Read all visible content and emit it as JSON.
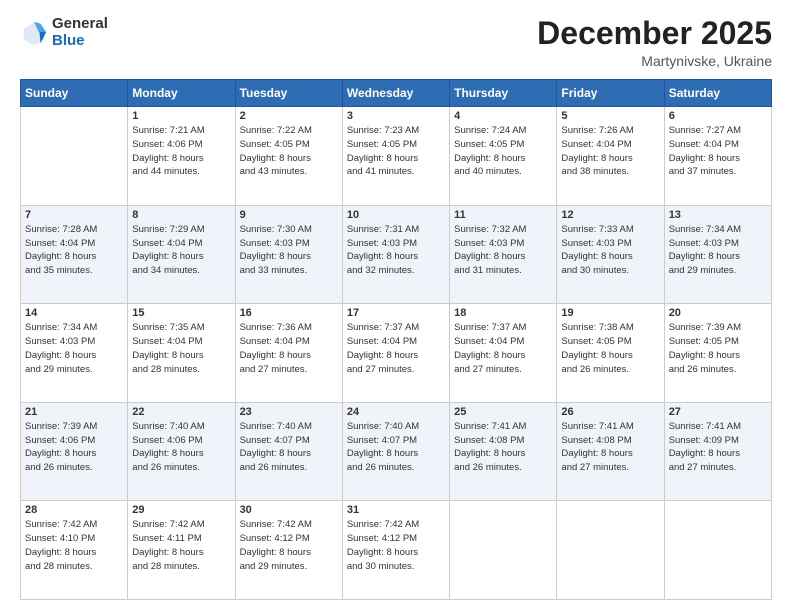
{
  "header": {
    "logo_general": "General",
    "logo_blue": "Blue",
    "title": "December 2025",
    "location": "Martynivske, Ukraine"
  },
  "days_of_week": [
    "Sunday",
    "Monday",
    "Tuesday",
    "Wednesday",
    "Thursday",
    "Friday",
    "Saturday"
  ],
  "weeks": [
    [
      {
        "day": "",
        "info": ""
      },
      {
        "day": "1",
        "info": "Sunrise: 7:21 AM\nSunset: 4:06 PM\nDaylight: 8 hours\nand 44 minutes."
      },
      {
        "day": "2",
        "info": "Sunrise: 7:22 AM\nSunset: 4:05 PM\nDaylight: 8 hours\nand 43 minutes."
      },
      {
        "day": "3",
        "info": "Sunrise: 7:23 AM\nSunset: 4:05 PM\nDaylight: 8 hours\nand 41 minutes."
      },
      {
        "day": "4",
        "info": "Sunrise: 7:24 AM\nSunset: 4:05 PM\nDaylight: 8 hours\nand 40 minutes."
      },
      {
        "day": "5",
        "info": "Sunrise: 7:26 AM\nSunset: 4:04 PM\nDaylight: 8 hours\nand 38 minutes."
      },
      {
        "day": "6",
        "info": "Sunrise: 7:27 AM\nSunset: 4:04 PM\nDaylight: 8 hours\nand 37 minutes."
      }
    ],
    [
      {
        "day": "7",
        "info": "Sunrise: 7:28 AM\nSunset: 4:04 PM\nDaylight: 8 hours\nand 35 minutes."
      },
      {
        "day": "8",
        "info": "Sunrise: 7:29 AM\nSunset: 4:04 PM\nDaylight: 8 hours\nand 34 minutes."
      },
      {
        "day": "9",
        "info": "Sunrise: 7:30 AM\nSunset: 4:03 PM\nDaylight: 8 hours\nand 33 minutes."
      },
      {
        "day": "10",
        "info": "Sunrise: 7:31 AM\nSunset: 4:03 PM\nDaylight: 8 hours\nand 32 minutes."
      },
      {
        "day": "11",
        "info": "Sunrise: 7:32 AM\nSunset: 4:03 PM\nDaylight: 8 hours\nand 31 minutes."
      },
      {
        "day": "12",
        "info": "Sunrise: 7:33 AM\nSunset: 4:03 PM\nDaylight: 8 hours\nand 30 minutes."
      },
      {
        "day": "13",
        "info": "Sunrise: 7:34 AM\nSunset: 4:03 PM\nDaylight: 8 hours\nand 29 minutes."
      }
    ],
    [
      {
        "day": "14",
        "info": "Sunrise: 7:34 AM\nSunset: 4:03 PM\nDaylight: 8 hours\nand 29 minutes."
      },
      {
        "day": "15",
        "info": "Sunrise: 7:35 AM\nSunset: 4:04 PM\nDaylight: 8 hours\nand 28 minutes."
      },
      {
        "day": "16",
        "info": "Sunrise: 7:36 AM\nSunset: 4:04 PM\nDaylight: 8 hours\nand 27 minutes."
      },
      {
        "day": "17",
        "info": "Sunrise: 7:37 AM\nSunset: 4:04 PM\nDaylight: 8 hours\nand 27 minutes."
      },
      {
        "day": "18",
        "info": "Sunrise: 7:37 AM\nSunset: 4:04 PM\nDaylight: 8 hours\nand 27 minutes."
      },
      {
        "day": "19",
        "info": "Sunrise: 7:38 AM\nSunset: 4:05 PM\nDaylight: 8 hours\nand 26 minutes."
      },
      {
        "day": "20",
        "info": "Sunrise: 7:39 AM\nSunset: 4:05 PM\nDaylight: 8 hours\nand 26 minutes."
      }
    ],
    [
      {
        "day": "21",
        "info": "Sunrise: 7:39 AM\nSunset: 4:06 PM\nDaylight: 8 hours\nand 26 minutes."
      },
      {
        "day": "22",
        "info": "Sunrise: 7:40 AM\nSunset: 4:06 PM\nDaylight: 8 hours\nand 26 minutes."
      },
      {
        "day": "23",
        "info": "Sunrise: 7:40 AM\nSunset: 4:07 PM\nDaylight: 8 hours\nand 26 minutes."
      },
      {
        "day": "24",
        "info": "Sunrise: 7:40 AM\nSunset: 4:07 PM\nDaylight: 8 hours\nand 26 minutes."
      },
      {
        "day": "25",
        "info": "Sunrise: 7:41 AM\nSunset: 4:08 PM\nDaylight: 8 hours\nand 26 minutes."
      },
      {
        "day": "26",
        "info": "Sunrise: 7:41 AM\nSunset: 4:08 PM\nDaylight: 8 hours\nand 27 minutes."
      },
      {
        "day": "27",
        "info": "Sunrise: 7:41 AM\nSunset: 4:09 PM\nDaylight: 8 hours\nand 27 minutes."
      }
    ],
    [
      {
        "day": "28",
        "info": "Sunrise: 7:42 AM\nSunset: 4:10 PM\nDaylight: 8 hours\nand 28 minutes."
      },
      {
        "day": "29",
        "info": "Sunrise: 7:42 AM\nSunset: 4:11 PM\nDaylight: 8 hours\nand 28 minutes."
      },
      {
        "day": "30",
        "info": "Sunrise: 7:42 AM\nSunset: 4:12 PM\nDaylight: 8 hours\nand 29 minutes."
      },
      {
        "day": "31",
        "info": "Sunrise: 7:42 AM\nSunset: 4:12 PM\nDaylight: 8 hours\nand 30 minutes."
      },
      {
        "day": "",
        "info": ""
      },
      {
        "day": "",
        "info": ""
      },
      {
        "day": "",
        "info": ""
      }
    ]
  ]
}
